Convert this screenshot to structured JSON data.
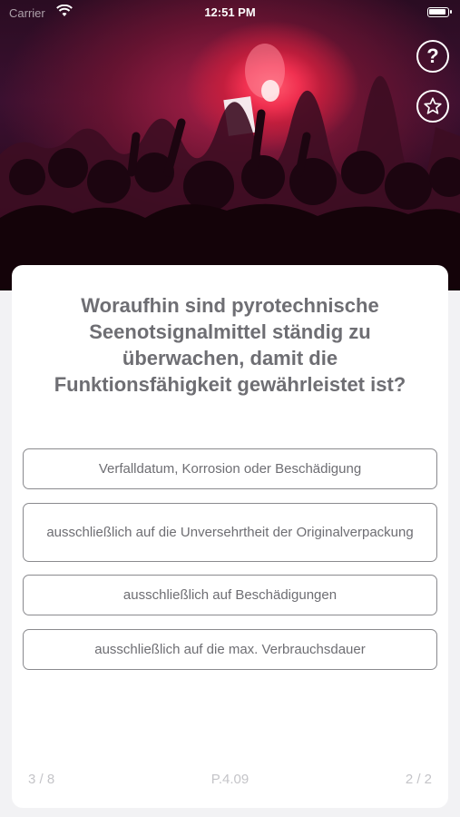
{
  "status_bar": {
    "carrier": "Carrier",
    "time": "12:51 PM"
  },
  "hero": {
    "image": "protest-crowd-red-flare-photo"
  },
  "toolbar": {
    "help_icon": "question-circle-icon",
    "favorite_icon": "star-circle-icon"
  },
  "question": {
    "text": "Woraufhin sind pyrotechnische Seenotsignalmittel ständig zu überwachen, damit die Funktionsfähigkeit gewährleistet ist?"
  },
  "answers": [
    {
      "label": "Verfalldatum, Korrosion oder Beschädigung"
    },
    {
      "label": "ausschließlich auf die Unversehrtheit der Originalverpackung"
    },
    {
      "label": "ausschließlich auf Beschädigungen"
    },
    {
      "label": "ausschließlich auf die max. Verbrauchsdauer"
    }
  ],
  "footer": {
    "progress": "3 / 8",
    "question_id": "P.4.09",
    "page": "2 / 2"
  },
  "colors": {
    "text_gray": "#6e6e73",
    "border_gray": "#8a8a8e",
    "footer_gray": "#c4c4c8",
    "background": "#f2f2f4"
  }
}
